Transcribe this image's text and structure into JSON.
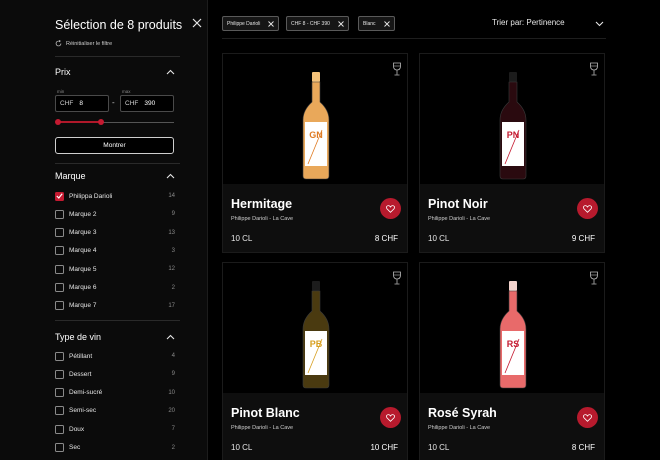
{
  "sidebar": {
    "title": "Sélection de 8 produits",
    "reset_label": "Réinitialiser le filtre",
    "price": {
      "heading": "Prix",
      "min_label": "min",
      "max_label": "max",
      "currency": "CHF",
      "min_value": "8",
      "max_value": "390",
      "slider_range": [
        8,
        390
      ],
      "slider_min": 8,
      "slider_max": 150,
      "button_label": "Montrer"
    },
    "marque": {
      "heading": "Marque",
      "options": [
        {
          "label": "Philippa Darioli",
          "count": "14",
          "checked": true
        },
        {
          "label": "Marque 2",
          "count": "9",
          "checked": false
        },
        {
          "label": "Marque 3",
          "count": "13",
          "checked": false
        },
        {
          "label": "Marque 4",
          "count": "3",
          "checked": false
        },
        {
          "label": "Marque 5",
          "count": "12",
          "checked": false
        },
        {
          "label": "Marque 6",
          "count": "2",
          "checked": false
        },
        {
          "label": "Marque 7",
          "count": "17",
          "checked": false
        }
      ]
    },
    "type_vin": {
      "heading": "Type de vin",
      "options": [
        {
          "label": "Pétillant",
          "count": "4",
          "checked": false
        },
        {
          "label": "Dessert",
          "count": "9",
          "checked": false
        },
        {
          "label": "Demi-sucré",
          "count": "10",
          "checked": false
        },
        {
          "label": "Semi-sec",
          "count": "20",
          "checked": false
        },
        {
          "label": "Doux",
          "count": "7",
          "checked": false
        },
        {
          "label": "Sec",
          "count": "2",
          "checked": false
        }
      ]
    }
  },
  "chips": [
    "Philippe Darioli",
    "CHF 8 - CHF 390",
    "Blanc"
  ],
  "sort": {
    "label": "Trier par:  Pertinence"
  },
  "products": [
    {
      "name": "Hermitage",
      "producer": "Philippe Darioli - La Cave",
      "volume": "10 CL",
      "price": "8 CHF",
      "label_text": "GN",
      "liquid": "#e9a85a",
      "label_color": "#ffffff",
      "mark_color": "#e07b22"
    },
    {
      "name": "Pinot Noir",
      "producer": "Philippe Darioli - La Cave",
      "volume": "10 CL",
      "price": "9 CHF",
      "label_text": "PN",
      "liquid": "#2a0a0f",
      "label_color": "#ffffff",
      "mark_color": "#c51a31"
    },
    {
      "name": "Pinot Blanc",
      "producer": "Philippe Darioli - La Cave",
      "volume": "10 CL",
      "price": "10 CHF",
      "label_text": "PB",
      "liquid": "#4a3a10",
      "label_color": "#ffffff",
      "mark_color": "#d8a020"
    },
    {
      "name": "Rosé Syrah",
      "producer": "Philippe Darioli - La Cave",
      "volume": "10 CL",
      "price": "8 CHF",
      "label_text": "RS",
      "liquid": "#e86a6a",
      "label_color": "#ffffff",
      "mark_color": "#c51a31"
    }
  ],
  "colors": {
    "accent": "#c51a31",
    "background": "#000000",
    "card": "#0e0e0e"
  },
  "icons": {
    "close": "close-icon",
    "reset": "refresh-icon",
    "chevron": "chevron-up-icon",
    "sort": "chevron-down-icon",
    "glass": "wine-glass-icon",
    "favorite": "heart-icon",
    "check": "check-icon"
  }
}
